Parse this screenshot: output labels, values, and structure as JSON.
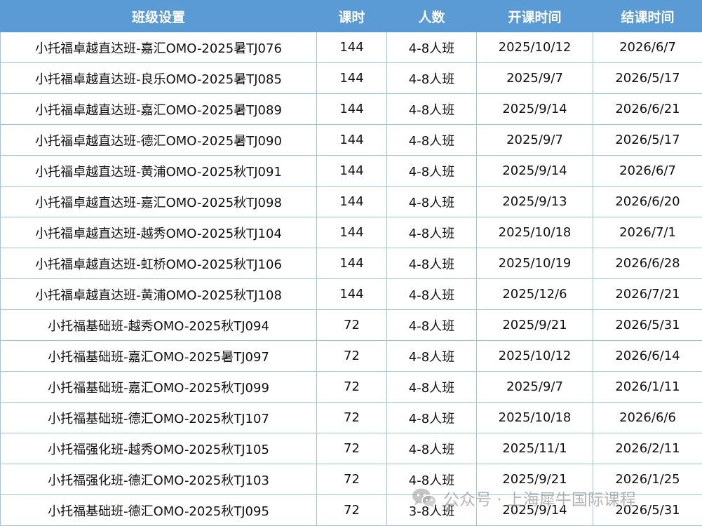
{
  "table": {
    "headers": [
      "班级设置",
      "课时",
      "人数",
      "开课时间",
      "结课时间"
    ],
    "rows": [
      [
        "小托福卓越直达班-嘉汇OMO-2025暑TJ076",
        "144",
        "4-8人班",
        "2025/10/12",
        "2026/6/7"
      ],
      [
        "小托福卓越直达班-良乐OMO-2025暑TJ085",
        "144",
        "4-8人班",
        "2025/9/7",
        "2026/5/17"
      ],
      [
        "小托福卓越直达班-嘉汇OMO-2025暑TJ089",
        "144",
        "4-8人班",
        "2025/9/14",
        "2026/6/21"
      ],
      [
        "小托福卓越直达班-德汇OMO-2025暑TJ090",
        "144",
        "4-8人班",
        "2025/9/7",
        "2026/5/17"
      ],
      [
        "小托福卓越直达班-黄浦OMO-2025秋TJ091",
        "144",
        "4-8人班",
        "2025/9/14",
        "2026/6/7"
      ],
      [
        "小托福卓越直达班-嘉汇OMO-2025秋TJ098",
        "144",
        "4-8人班",
        "2025/9/13",
        "2026/6/20"
      ],
      [
        "小托福卓越直达班-越秀OMO-2025秋TJ104",
        "144",
        "4-8人班",
        "2025/10/18",
        "2026/7/1"
      ],
      [
        "小托福卓越直达班-虹桥OMO-2025秋TJ106",
        "144",
        "4-8人班",
        "2025/10/19",
        "2026/6/28"
      ],
      [
        "小托福卓越直达班-黄浦OMO-2025秋TJ108",
        "144",
        "4-8人班",
        "2025/12/6",
        "2026/7/21"
      ],
      [
        "小托福基础班-越秀OMO-2025秋TJ094",
        "72",
        "4-8人班",
        "2025/9/21",
        "2026/5/31"
      ],
      [
        "小托福基础班-嘉汇OMO-2025暑TJ097",
        "72",
        "4-8人班",
        "2025/10/12",
        "2026/6/14"
      ],
      [
        "小托福基础班-嘉汇OMO-2025秋TJ099",
        "72",
        "4-8人班",
        "2025/9/7",
        "2026/1/11"
      ],
      [
        "小托福基础班-德汇OMO-2025秋TJ107",
        "72",
        "4-8人班",
        "2025/10/18",
        "2026/6/6"
      ],
      [
        "小托福强化班-越秀OMO-2025秋TJ105",
        "72",
        "4-8人班",
        "2025/11/1",
        "2026/2/11"
      ],
      [
        "小托福强化班-德汇OMO-2025秋TJ103",
        "72",
        "4-8人班",
        "2025/9/21",
        "2026/1/25"
      ],
      [
        "小托福基础班-德汇OMO-2025秋TJ095",
        "72",
        "3-8人班",
        "2025/9/14",
        "2026/5/31"
      ]
    ]
  },
  "watermark": {
    "icon": "wechat-icon",
    "text": "公众号 · 上海犀牛国际课程"
  },
  "colors": {
    "header_bg": "#5b9bd5",
    "header_text": "#ffffff",
    "grid": "#9dc3e6"
  }
}
